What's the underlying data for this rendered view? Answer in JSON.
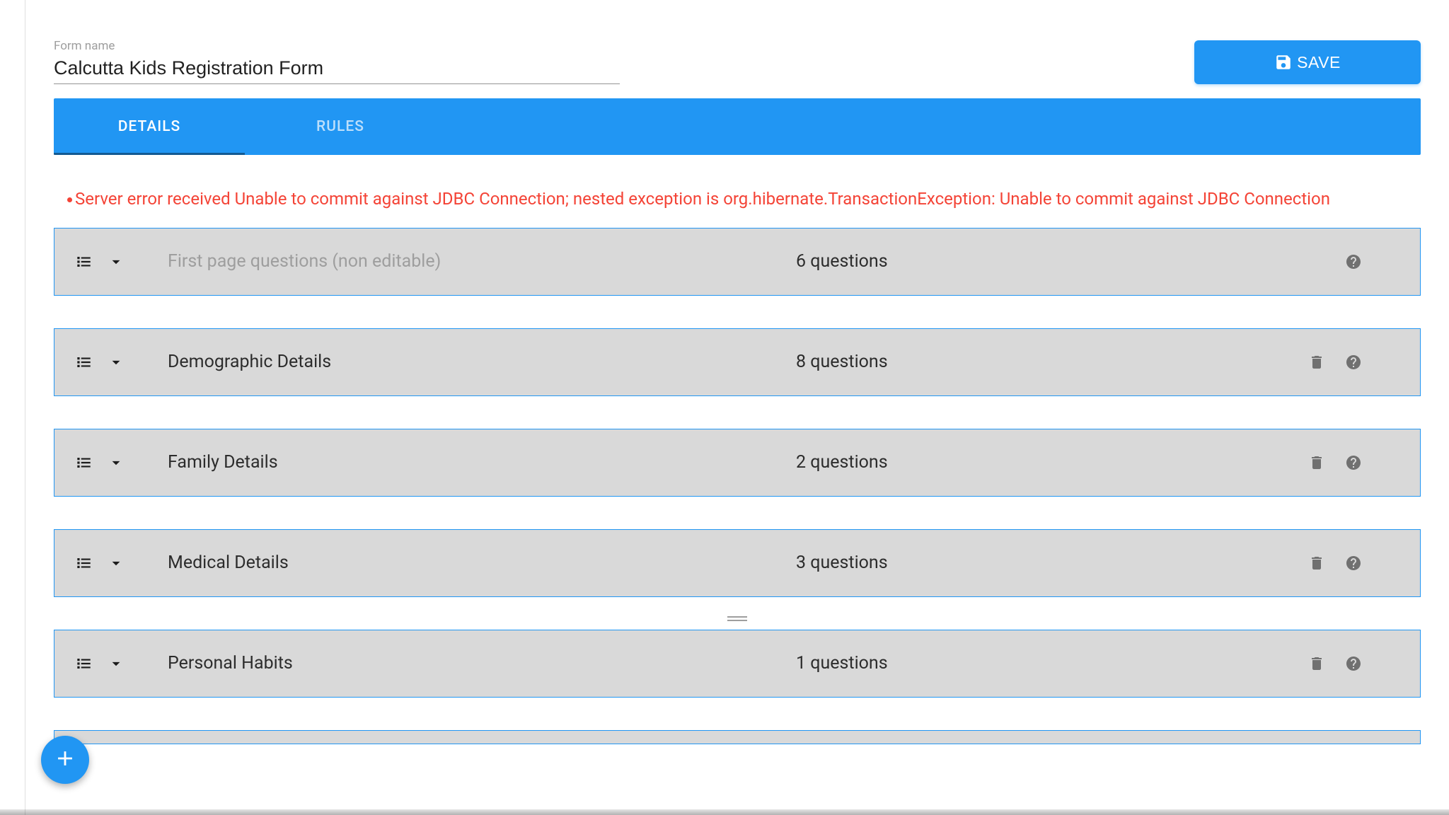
{
  "form": {
    "name_label": "Form name",
    "name_value": "Calcutta Kids Registration Form"
  },
  "save_button_label": "SAVE",
  "tabs": [
    {
      "label": "DETAILS"
    },
    {
      "label": "RULES"
    }
  ],
  "error_message": "Server error received Unable to commit against JDBC Connection; nested exception is org.hibernate.TransactionException: Unable to commit against JDBC Connection",
  "sections": [
    {
      "title": "First page questions (non editable)",
      "count": "6 questions",
      "readonly": true
    },
    {
      "title": "Demographic Details",
      "count": "8 questions",
      "readonly": false
    },
    {
      "title": "Family Details",
      "count": "2 questions",
      "readonly": false
    },
    {
      "title": "Medical Details",
      "count": "3 questions",
      "readonly": false
    },
    {
      "title": "Personal Habits",
      "count": "1 questions",
      "readonly": false,
      "showDragFloat": true
    }
  ]
}
